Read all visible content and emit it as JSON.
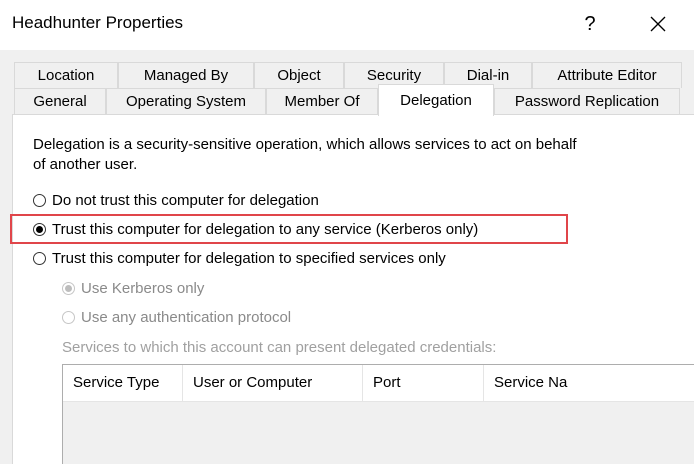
{
  "window": {
    "title": "Headhunter Properties",
    "help_label": "?",
    "close_icon": "close-icon"
  },
  "tabs": {
    "row1": [
      "Location",
      "Managed By",
      "Object",
      "Security",
      "Dial-in",
      "Attribute Editor"
    ],
    "row2": [
      "General",
      "Operating System",
      "Member Of",
      "Delegation",
      "Password Replication"
    ],
    "active": "Delegation"
  },
  "delegation": {
    "description": "Delegation is a security-sensitive operation, which allows services to act on behalf of another user.",
    "options": [
      {
        "label": "Do not trust this computer for delegation",
        "checked": false
      },
      {
        "label": "Trust this computer for delegation to any service (Kerberos only)",
        "checked": true
      },
      {
        "label": "Trust this computer for delegation to specified services only",
        "checked": false
      }
    ],
    "sub_options": [
      {
        "label": "Use Kerberos only",
        "checked": true,
        "disabled": true
      },
      {
        "label": "Use any authentication protocol",
        "checked": false,
        "disabled": true
      }
    ],
    "services_label": "Services to which this account can present delegated credentials:",
    "columns": [
      "Service Type",
      "User or Computer",
      "Port",
      "Service Na"
    ]
  },
  "colors": {
    "highlight": "#e0454a",
    "dialog_bg": "#f0f0f0"
  }
}
